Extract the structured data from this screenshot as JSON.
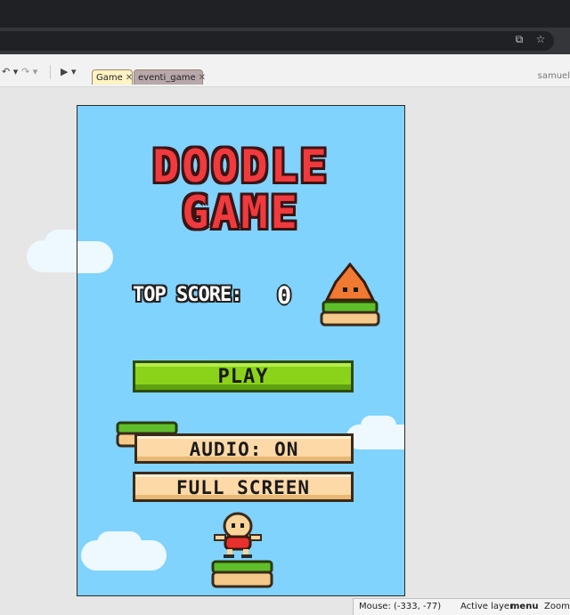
{
  "browser": {
    "address_icons": [
      "open-in-new-icon",
      "star-icon"
    ]
  },
  "toolbar": {
    "icons": [
      "undo-icon",
      "redo-icon",
      "play-icon"
    ],
    "tabs": [
      {
        "label": "Game",
        "close": "✕"
      },
      {
        "label": "eventi_game",
        "close": "✕"
      }
    ],
    "user": "samuel"
  },
  "game": {
    "title_line1": "DOODLE",
    "title_line2": "GAME",
    "top_score_label": "TOP SCORE:",
    "top_score_value": "0",
    "play_label": "PLAY",
    "audio_label": "AUDIO: ON",
    "fullscreen_label": "FULL SCREEN"
  },
  "statusbar": {
    "mouse": "Mouse: (-333, -77)",
    "layer_label": "Active layer:",
    "layer_value": "menu",
    "zoom": "Zoom:"
  },
  "colors": {
    "sky": "#7fd3fd",
    "title_red": "#f03a3e",
    "play_green": "#8bd31a",
    "button_beige": "#fcd9a6"
  }
}
